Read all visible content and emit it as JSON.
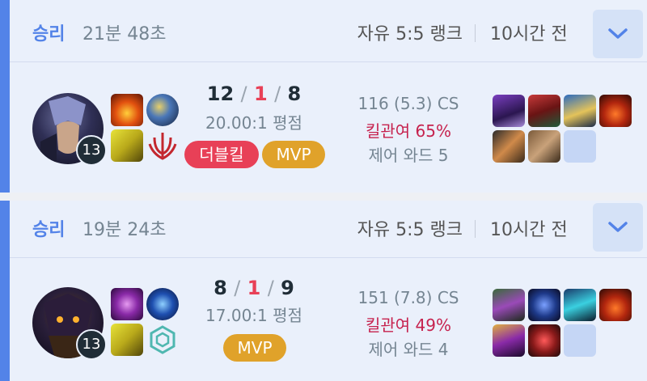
{
  "matches": [
    {
      "result": "승리",
      "duration": "21분 48초",
      "queue": "자유 5:5 랭크",
      "time_ago": "10시간 전",
      "champion_level": "13",
      "kda": {
        "kills": "12",
        "deaths": "1",
        "assists": "8"
      },
      "kda_ratio": "20.00:1 평점",
      "badges": [
        "더블킬",
        "MVP"
      ],
      "cs": "116 (5.3) CS",
      "kill_participation": "킬관여 65%",
      "control_wards": "제어 와드 5"
    },
    {
      "result": "승리",
      "duration": "19분 24초",
      "queue": "자유 5:5 랭크",
      "time_ago": "10시간 전",
      "champion_level": "13",
      "kda": {
        "kills": "8",
        "deaths": "1",
        "assists": "9"
      },
      "kda_ratio": "17.00:1 평점",
      "badges": [
        "MVP"
      ],
      "cs": "151 (7.8) CS",
      "kill_participation": "킬관여 49%",
      "control_wards": "제어 와드 4"
    }
  ],
  "slash": "/",
  "colors": {
    "win_accent": "#5383e8",
    "death": "#e84057",
    "kill_participation": "#c6224e",
    "mvp": "#e0a22a",
    "multikill": "#e84057"
  },
  "icons": [
    "chevron-down-icon"
  ]
}
